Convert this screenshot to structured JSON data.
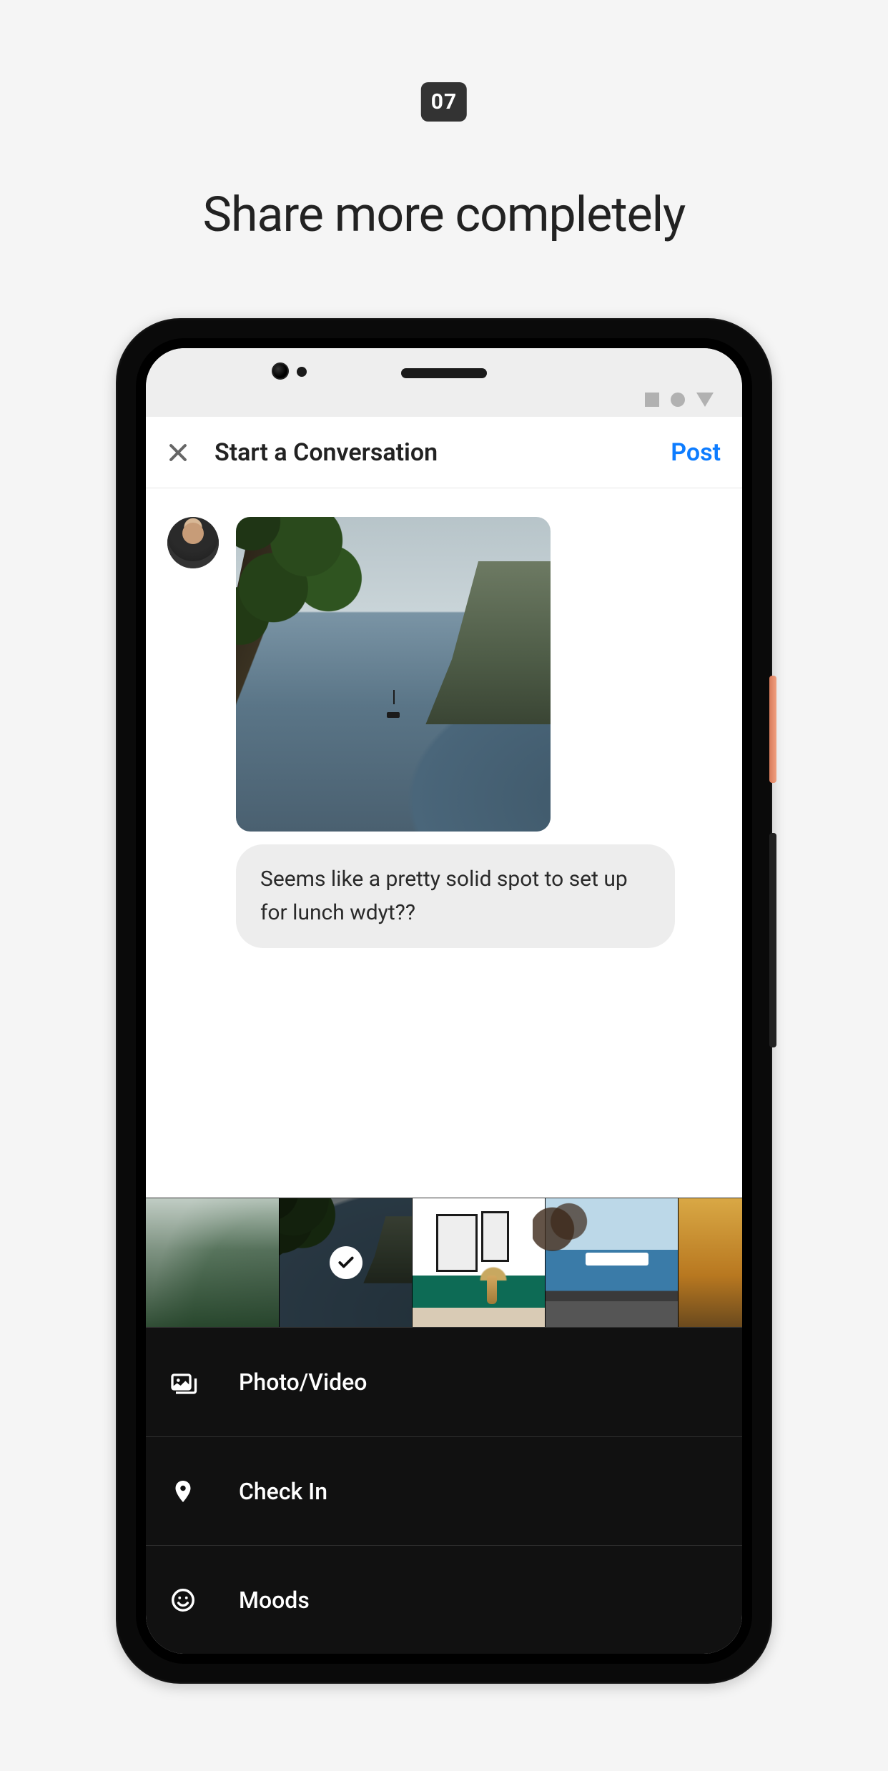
{
  "page": {
    "badge": "07",
    "title": "Share more completely"
  },
  "topbar": {
    "title": "Start a Conversation",
    "post_label": "Post"
  },
  "composer": {
    "message": "Seems like a pretty solid spot to set up for lunch wdyt??"
  },
  "gallery": {
    "selected_index": 1,
    "thumbs": [
      "forest",
      "sea",
      "room",
      "street",
      "autumn"
    ]
  },
  "attach_menu": {
    "photo_video": "Photo/Video",
    "check_in": "Check In",
    "moods": "Moods"
  }
}
